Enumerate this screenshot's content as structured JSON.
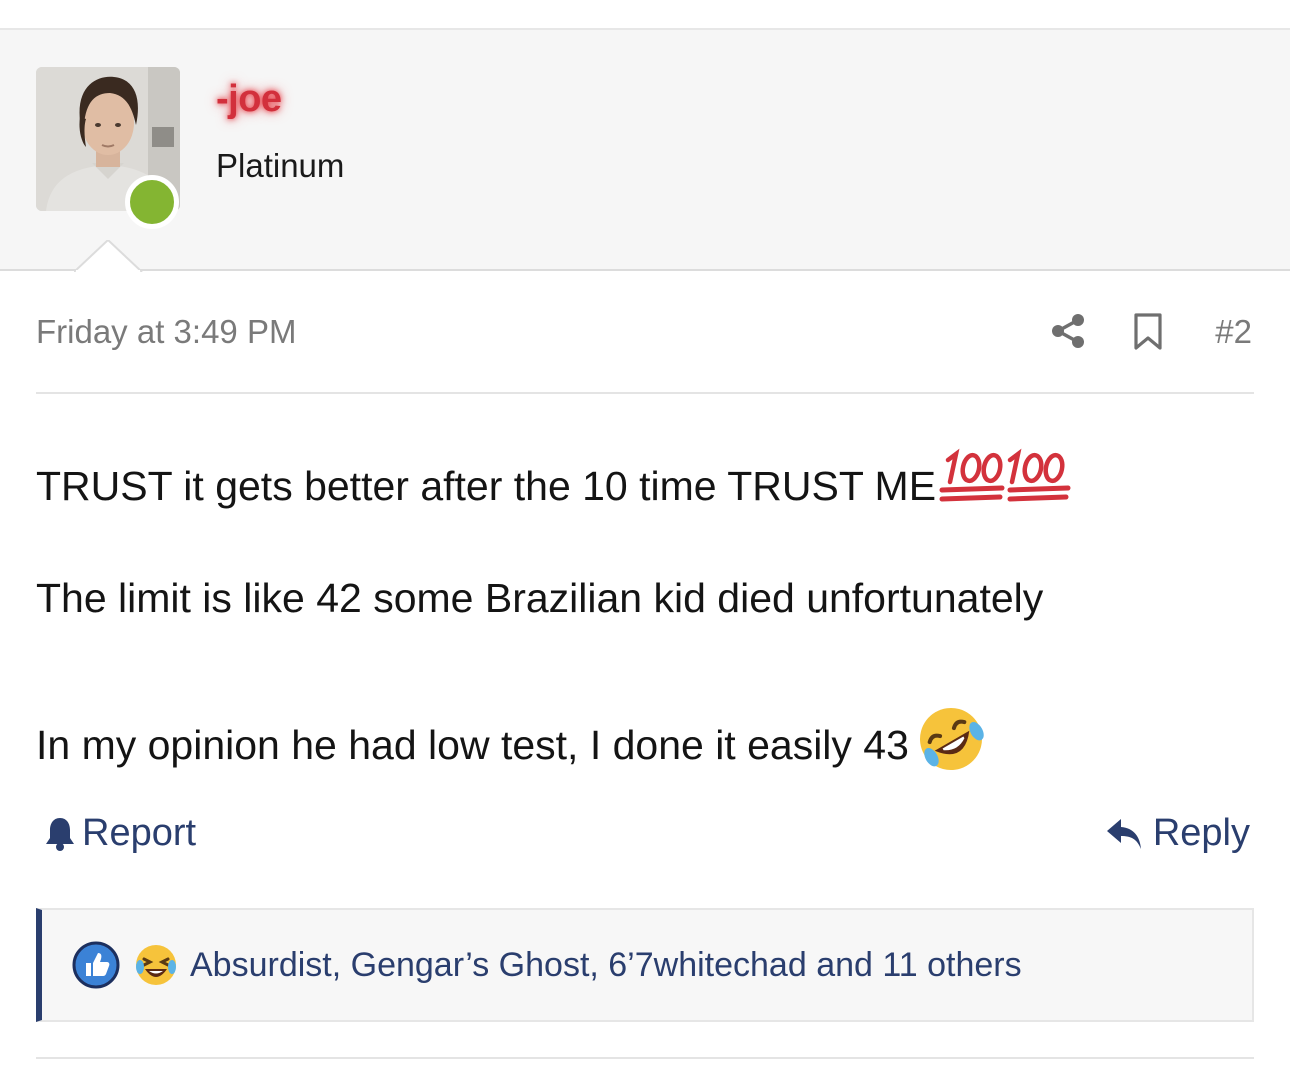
{
  "user": {
    "name": "-joe",
    "title": "Platinum",
    "name_color": "#d2303c",
    "online_color": "#84b532"
  },
  "post": {
    "timestamp": "Friday at 3:49 PM",
    "number": "#2",
    "lines": [
      "TRUST it gets better after the 10 time TRUST ME",
      "The limit is like 42 some Brazilian kid died unfortunately",
      "In my opinion he had low test, I done it easily 43"
    ],
    "emojis": [
      "hundred-points-emoji",
      "rolling-on-floor-laughing-emoji"
    ]
  },
  "actions": {
    "report_label": "Report",
    "reply_label": "Reply"
  },
  "reactions": {
    "text": "Absurdist, Gengar’s Ghost, 6’7whitechad and 11 others",
    "icons": [
      "like-icon",
      "haha-icon"
    ]
  },
  "colors": {
    "link": "#2a3e6e",
    "accent_bar": "#2a3e6e",
    "muted": "#7a7a7a"
  }
}
